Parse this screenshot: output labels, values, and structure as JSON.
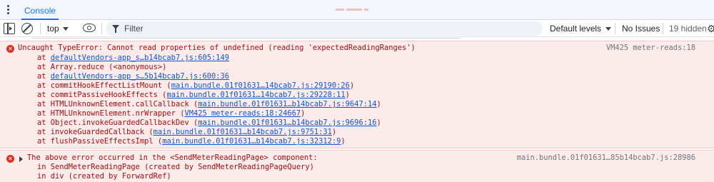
{
  "drawer": {
    "tab_label": "Console"
  },
  "toolbar": {
    "context": "top",
    "filter_placeholder": "Filter",
    "levels": "Default levels",
    "issues": "No Issues",
    "hidden": "19 hidden"
  },
  "error1": {
    "message": "Uncaught TypeError: Cannot read properties of undefined (reading 'expectedReadingRanges')",
    "source": "VM425 meter-reads:18",
    "frames": [
      {
        "prefix": "at ",
        "fn": "",
        "link": "defaultVendors-app_s…b14bcab7.js:605:149",
        "suffix": ""
      },
      {
        "prefix": "at ",
        "fn": "Array.reduce (<anonymous>)",
        "link": "",
        "suffix": ""
      },
      {
        "prefix": "at ",
        "fn": "",
        "link": "defaultVendors-app_s…5b14bcab7.js:600:36",
        "suffix": ""
      },
      {
        "prefix": "at ",
        "fn": "commitHookEffectListMount (",
        "link": "main.bundle.01f01631…14bcab7.js:29190:26",
        "suffix": ")"
      },
      {
        "prefix": "at ",
        "fn": "commitPassiveHookEffects (",
        "link": "main.bundle.01f01631…14bcab7.js:29228:11",
        "suffix": ")"
      },
      {
        "prefix": "at ",
        "fn": "HTMLUnknownElement.callCallback (",
        "link": "main.bundle.01f01631…b14bcab7.js:9647:14",
        "suffix": ")"
      },
      {
        "prefix": "at ",
        "fn": "HTMLUnknownElement.nrWrapper (",
        "link": "VM425 meter-reads:18:24667",
        "suffix": ")"
      },
      {
        "prefix": "at ",
        "fn": "Object.invokeGuardedCallbackDev (",
        "link": "main.bundle.01f01631…b14bcab7.js:9696:16",
        "suffix": ")"
      },
      {
        "prefix": "at ",
        "fn": "invokeGuardedCallback (",
        "link": "main.bundle.01f01631…b14bcab7.js:9751:31",
        "suffix": ")"
      },
      {
        "prefix": "at ",
        "fn": "flushPassiveEffectsImpl (",
        "link": "main.bundle.01f01631…b14bcab7.js:32312:9",
        "suffix": ")"
      }
    ]
  },
  "error2": {
    "message": "The above error occurred in the <SendMeterReadingPage> component:",
    "source": "main.bundle.01f01631…85b14bcab7.js:28986",
    "lines": [
      "in SendMeterReadingPage (created by SendMeterReadingPageQuery)",
      "in div (created by ForwardRef)"
    ]
  },
  "colors": {
    "error_bg": "#fcebeb",
    "error_text": "#a50e0e",
    "link": "#0b57d0",
    "accent": "#1a73e8"
  },
  "icons": [
    "kebab-menu-icon",
    "sidebar-toggle-icon",
    "clear-console-icon",
    "eye-icon",
    "filter-icon",
    "settings-icon",
    "error-icon",
    "expand-triangle-icon"
  ]
}
